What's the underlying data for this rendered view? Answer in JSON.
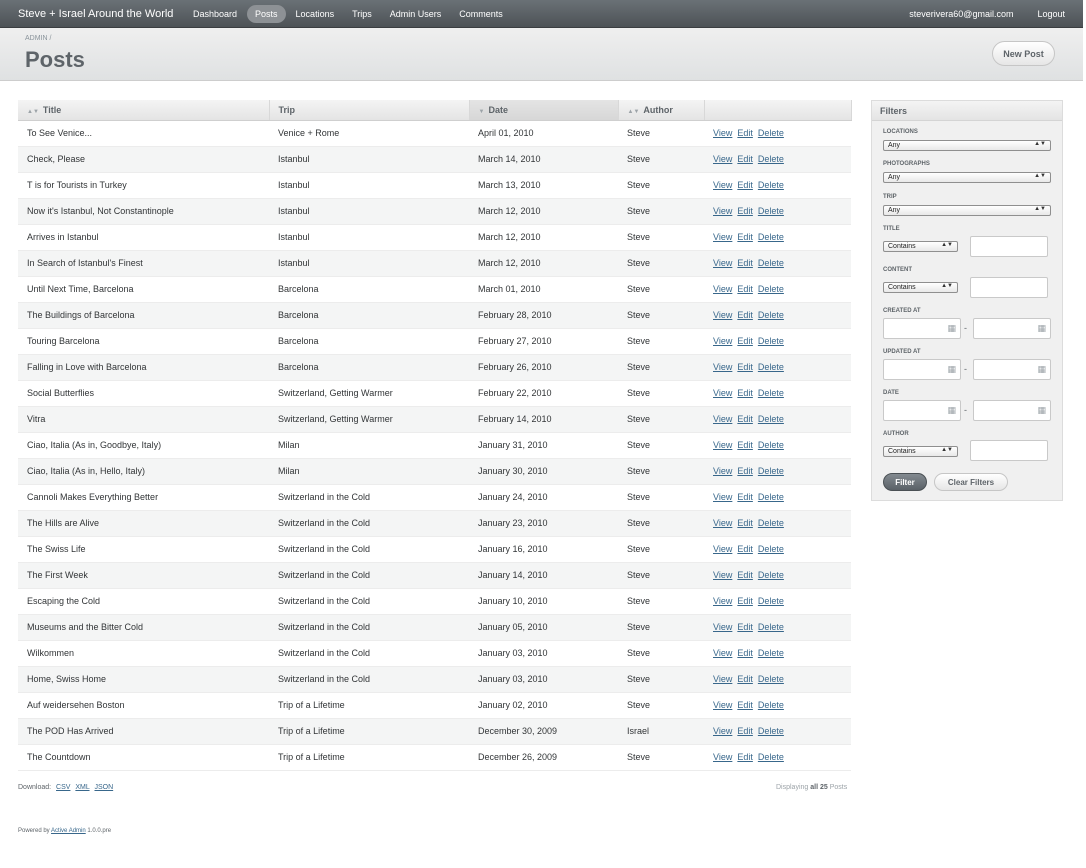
{
  "header": {
    "site_title": "Steve + Israel Around the World",
    "tabs": [
      "Dashboard",
      "Posts",
      "Locations",
      "Trips",
      "Admin Users",
      "Comments"
    ],
    "current_tab": "Posts",
    "user_email": "steverivera60@gmail.com",
    "logout_label": "Logout"
  },
  "title_bar": {
    "breadcrumb_admin": "ADMIN",
    "breadcrumb_separator": "/",
    "page_title": "Posts",
    "new_post_label": "New Post"
  },
  "table": {
    "columns": [
      "Title",
      "Trip",
      "Date",
      "Author"
    ],
    "sorted_column": "Date",
    "action_labels": {
      "view": "View",
      "edit": "Edit",
      "delete": "Delete"
    },
    "rows": [
      {
        "title": "To See Venice...",
        "trip": "Venice + Rome",
        "date": "April 01, 2010",
        "author": "Steve"
      },
      {
        "title": "Check, Please",
        "trip": "Istanbul",
        "date": "March 14, 2010",
        "author": "Steve"
      },
      {
        "title": "T is for Tourists in Turkey",
        "trip": "Istanbul",
        "date": "March 13, 2010",
        "author": "Steve"
      },
      {
        "title": "Now it's Istanbul, Not Constantinople",
        "trip": "Istanbul",
        "date": "March 12, 2010",
        "author": "Steve"
      },
      {
        "title": "Arrives in Istanbul",
        "trip": "Istanbul",
        "date": "March 12, 2010",
        "author": "Steve"
      },
      {
        "title": "In Search of Istanbul's Finest",
        "trip": "Istanbul",
        "date": "March 12, 2010",
        "author": "Steve"
      },
      {
        "title": "Until Next Time, Barcelona",
        "trip": "Barcelona",
        "date": "March 01, 2010",
        "author": "Steve"
      },
      {
        "title": "The Buildings of Barcelona",
        "trip": "Barcelona",
        "date": "February 28, 2010",
        "author": "Steve"
      },
      {
        "title": "Touring Barcelona",
        "trip": "Barcelona",
        "date": "February 27, 2010",
        "author": "Steve"
      },
      {
        "title": "Falling in Love with Barcelona",
        "trip": "Barcelona",
        "date": "February 26, 2010",
        "author": "Steve"
      },
      {
        "title": "Social Butterflies",
        "trip": "Switzerland, Getting Warmer",
        "date": "February 22, 2010",
        "author": "Steve"
      },
      {
        "title": "Vitra",
        "trip": "Switzerland, Getting Warmer",
        "date": "February 14, 2010",
        "author": "Steve"
      },
      {
        "title": "Ciao, Italia (As in, Goodbye, Italy)",
        "trip": "Milan",
        "date": "January 31, 2010",
        "author": "Steve"
      },
      {
        "title": "Ciao, Italia (As in, Hello, Italy)",
        "trip": "Milan",
        "date": "January 30, 2010",
        "author": "Steve"
      },
      {
        "title": "Cannoli Makes Everything Better",
        "trip": "Switzerland in the Cold",
        "date": "January 24, 2010",
        "author": "Steve"
      },
      {
        "title": "The Hills are Alive",
        "trip": "Switzerland in the Cold",
        "date": "January 23, 2010",
        "author": "Steve"
      },
      {
        "title": "The Swiss Life",
        "trip": "Switzerland in the Cold",
        "date": "January 16, 2010",
        "author": "Steve"
      },
      {
        "title": "The First Week",
        "trip": "Switzerland in the Cold",
        "date": "January 14, 2010",
        "author": "Steve"
      },
      {
        "title": "Escaping the Cold",
        "trip": "Switzerland in the Cold",
        "date": "January 10, 2010",
        "author": "Steve"
      },
      {
        "title": "Museums and the Bitter Cold",
        "trip": "Switzerland in the Cold",
        "date": "January 05, 2010",
        "author": "Steve"
      },
      {
        "title": "Wilkommen",
        "trip": "Switzerland in the Cold",
        "date": "January 03, 2010",
        "author": "Steve"
      },
      {
        "title": "Home, Swiss Home",
        "trip": "Switzerland in the Cold",
        "date": "January 03, 2010",
        "author": "Steve"
      },
      {
        "title": "Auf weidersehen Boston",
        "trip": "Trip of a Lifetime",
        "date": "January 02, 2010",
        "author": "Steve"
      },
      {
        "title": "The POD Has Arrived",
        "trip": "Trip of a Lifetime",
        "date": "December 30, 2009",
        "author": "Israel"
      },
      {
        "title": "The Countdown",
        "trip": "Trip of a Lifetime",
        "date": "December 26, 2009",
        "author": "Steve"
      }
    ]
  },
  "download": {
    "label": "Download:",
    "formats": [
      "CSV",
      "XML",
      "JSON"
    ]
  },
  "pagination": {
    "prefix": "Displaying",
    "all_label": "all 25",
    "suffix": "Posts"
  },
  "footer": {
    "prefix": "Powered by",
    "link": "Active Admin",
    "version": "1.0.0.pre"
  },
  "filters": {
    "title": "Filters",
    "locations_label": "Locations",
    "locations_value": "Any",
    "photographs_label": "Photographs",
    "photographs_value": "Any",
    "trip_label": "Trip",
    "trip_value": "Any",
    "title_label": "Title",
    "title_op": "Contains",
    "content_label": "Content",
    "content_op": "Contains",
    "created_at_label": "Created At",
    "updated_at_label": "Updated At",
    "date_label": "Date",
    "author_label": "Author",
    "author_op": "Contains",
    "range_separator": "-",
    "filter_button": "Filter",
    "clear_button": "Clear Filters"
  },
  "icons": {
    "sort": "sort-arrows-icon",
    "sort_desc": "sort-desc-icon",
    "calendar": "calendar-icon",
    "select_arrows": "select-arrows-icon"
  },
  "colors": {
    "header_bg": "#5a6065",
    "link": "#38678b",
    "title": "#5e6469"
  }
}
